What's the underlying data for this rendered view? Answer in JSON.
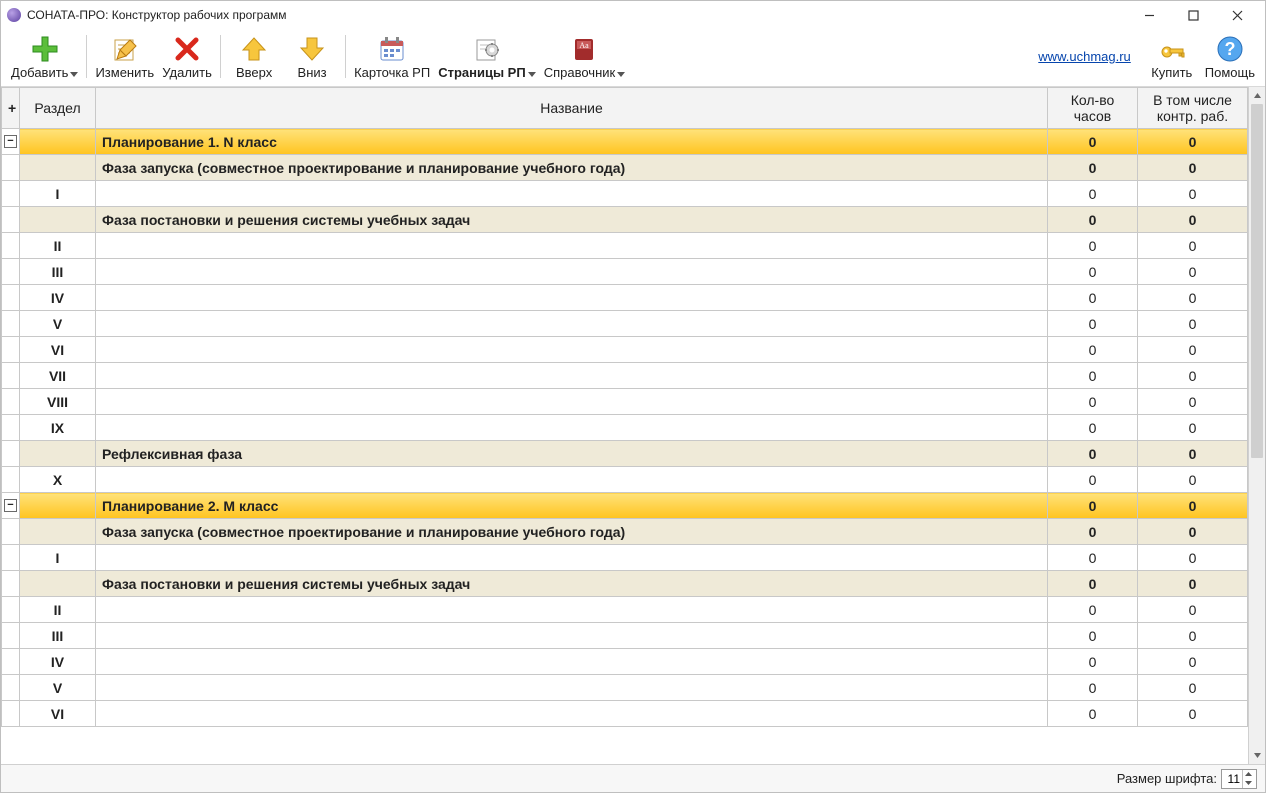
{
  "window": {
    "title": "СОНАТА-ПРО: Конструктор рабочих программ"
  },
  "toolbar": {
    "add": "Добавить",
    "edit": "Изменить",
    "delete": "Удалить",
    "up": "Вверх",
    "down": "Вниз",
    "card": "Карточка РП",
    "pages": "Страницы РП",
    "reference": "Справочник",
    "link": "www.uchmag.ru",
    "buy": "Купить",
    "help": "Помощь"
  },
  "headers": {
    "plus": "+",
    "section": "Раздел",
    "name": "Название",
    "hours": "Кол-во часов",
    "kontr": "В том числе контр. раб."
  },
  "rows": [
    {
      "type": "plan",
      "expand": "−",
      "section": "",
      "name": "Планирование 1. N класс",
      "hours": "0",
      "kontr": "0"
    },
    {
      "type": "phase",
      "section": "",
      "name": "Фаза запуска (совместное проектирование и  планирование учебного года)",
      "hours": "0",
      "kontr": "0"
    },
    {
      "type": "item",
      "section": "I",
      "name": "",
      "hours": "0",
      "kontr": "0"
    },
    {
      "type": "phase",
      "section": "",
      "name": "Фаза постановки и решения системы учебных задач",
      "hours": "0",
      "kontr": "0"
    },
    {
      "type": "item",
      "section": "II",
      "name": "",
      "hours": "0",
      "kontr": "0"
    },
    {
      "type": "item",
      "section": "III",
      "name": "",
      "hours": "0",
      "kontr": "0"
    },
    {
      "type": "item",
      "section": "IV",
      "name": "",
      "hours": "0",
      "kontr": "0"
    },
    {
      "type": "item",
      "section": "V",
      "name": "",
      "hours": "0",
      "kontr": "0"
    },
    {
      "type": "item",
      "section": "VI",
      "name": "",
      "hours": "0",
      "kontr": "0"
    },
    {
      "type": "item",
      "section": "VII",
      "name": "",
      "hours": "0",
      "kontr": "0"
    },
    {
      "type": "item",
      "section": "VIII",
      "name": "",
      "hours": "0",
      "kontr": "0"
    },
    {
      "type": "item",
      "section": "IX",
      "name": "",
      "hours": "0",
      "kontr": "0"
    },
    {
      "type": "phase",
      "section": "",
      "name": "Рефлексивная фаза",
      "hours": "0",
      "kontr": "0"
    },
    {
      "type": "item",
      "section": "X",
      "name": "",
      "hours": "0",
      "kontr": "0"
    },
    {
      "type": "plan",
      "expand": "−",
      "section": "",
      "name": "Планирование 2. M класс",
      "hours": "0",
      "kontr": "0"
    },
    {
      "type": "phase",
      "section": "",
      "name": "Фаза запуска (совместное проектирование и  планирование учебного года)",
      "hours": "0",
      "kontr": "0"
    },
    {
      "type": "item",
      "section": "I",
      "name": "",
      "hours": "0",
      "kontr": "0"
    },
    {
      "type": "phase",
      "section": "",
      "name": "Фаза постановки и решения системы учебных задач",
      "hours": "0",
      "kontr": "0"
    },
    {
      "type": "item",
      "section": "II",
      "name": "",
      "hours": "0",
      "kontr": "0"
    },
    {
      "type": "item",
      "section": "III",
      "name": "",
      "hours": "0",
      "kontr": "0"
    },
    {
      "type": "item",
      "section": "IV",
      "name": "",
      "hours": "0",
      "kontr": "0"
    },
    {
      "type": "item",
      "section": "V",
      "name": "",
      "hours": "0",
      "kontr": "0"
    },
    {
      "type": "item",
      "section": "VI",
      "name": "",
      "hours": "0",
      "kontr": "0"
    }
  ],
  "status": {
    "font_label": "Размер шрифта:",
    "font_value": "11"
  }
}
